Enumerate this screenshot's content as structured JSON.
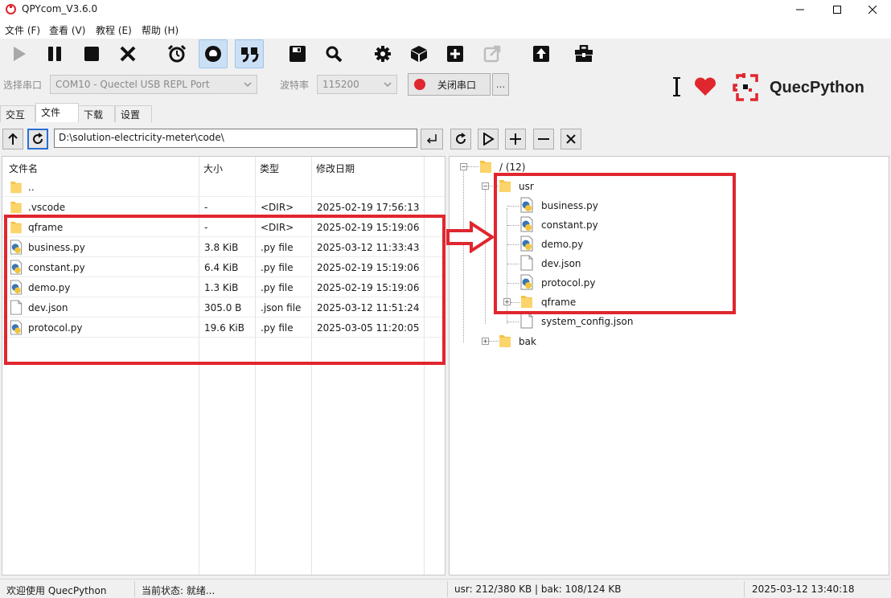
{
  "window": {
    "title": "QPYcom_V3.6.0"
  },
  "menu": [
    "文件 (F)",
    "查看 (V)",
    "教程 (E)",
    "帮助 (H)"
  ],
  "toolbar_icons": [
    "play-icon",
    "pause-icon",
    "stop-icon",
    "close-x-icon",
    "alarm-clock-icon",
    "robot-icon",
    "quote-icon",
    "save-icon",
    "search-icon",
    "gear-icon",
    "package-box-icon",
    "plus-square-icon",
    "external-link-icon",
    "upload-icon",
    "toolbox-icon"
  ],
  "serial": {
    "port_label": "选择串口",
    "port_value": "COM10 - Quectel USB REPL Port",
    "baud_label": "波特率",
    "baud_value": "115200",
    "toggle_button": "关闭串口",
    "more_button": "..."
  },
  "brand": {
    "text": "QuecPython",
    "color": "#e0262e"
  },
  "tabs": [
    "交互",
    "文件",
    "下载",
    "设置"
  ],
  "local": {
    "path": "D:\\solution-electricity-meter\\code\\",
    "headers": {
      "name": "文件名",
      "size": "大小",
      "type": "类型",
      "date": "修改日期"
    },
    "rows": [
      {
        "name": "..",
        "size": "",
        "type": "",
        "date": "",
        "icon": "folder"
      },
      {
        "name": ".vscode",
        "size": "-",
        "type": "<DIR>",
        "date": "2025-02-19 17:56:13",
        "icon": "folder"
      },
      {
        "name": "qframe",
        "size": "-",
        "type": "<DIR>",
        "date": "2025-02-19 15:19:06",
        "icon": "folder"
      },
      {
        "name": "business.py",
        "size": "3.8 KiB",
        "type": ".py file",
        "date": "2025-03-12 11:33:43",
        "icon": "python"
      },
      {
        "name": "constant.py",
        "size": "6.4 KiB",
        "type": ".py file",
        "date": "2025-02-19 15:19:06",
        "icon": "python"
      },
      {
        "name": "demo.py",
        "size": "1.3 KiB",
        "type": ".py file",
        "date": "2025-02-19 15:19:06",
        "icon": "python"
      },
      {
        "name": "dev.json",
        "size": "305.0 B",
        "type": ".json file",
        "date": "2025-03-12 11:51:24",
        "icon": "file"
      },
      {
        "name": "protocol.py",
        "size": "19.6 KiB",
        "type": ".py file",
        "date": "2025-03-05 11:20:05",
        "icon": "python"
      }
    ]
  },
  "device": {
    "root": "/ (12)",
    "usr": "usr",
    "usr_children": [
      {
        "name": "business.py",
        "icon": "python"
      },
      {
        "name": "constant.py",
        "icon": "python"
      },
      {
        "name": "demo.py",
        "icon": "python"
      },
      {
        "name": "dev.json",
        "icon": "file"
      },
      {
        "name": "protocol.py",
        "icon": "python"
      },
      {
        "name": "qframe",
        "icon": "folder"
      },
      {
        "name": "system_config.json",
        "icon": "file"
      }
    ],
    "bak": "bak"
  },
  "status": {
    "welcome": "欢迎使用 QuecPython",
    "state": "当前状态: 就绪...",
    "storage": "usr: 212/380 KB | bak: 108/124 KB",
    "datetime": "2025-03-12 13:40:18"
  }
}
